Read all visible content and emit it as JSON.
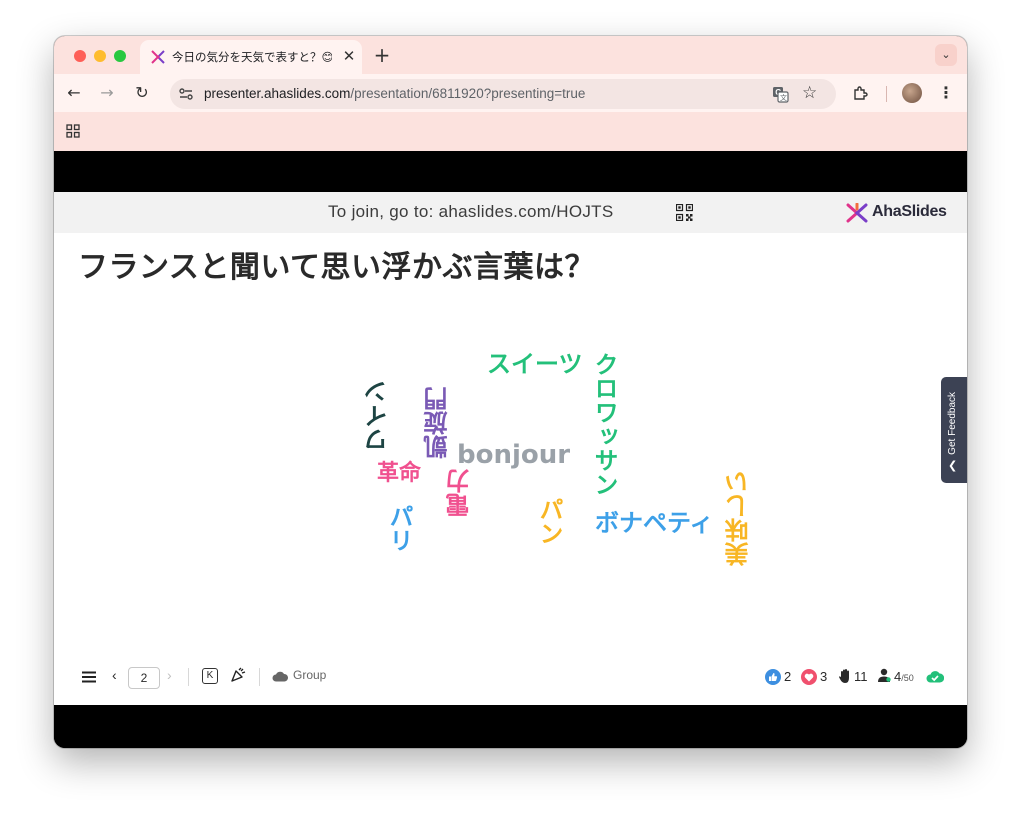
{
  "browser": {
    "tab": {
      "title": "今日の気分を天気で表すと？😊🌤️",
      "close": "✕"
    },
    "new_tab": "+",
    "tab_menu": "⌄",
    "url_host": "presenter.ahaslides.com",
    "url_path": "/presentation/6811920?presenting=true"
  },
  "slide": {
    "join_prefix": "To join, go to: ",
    "join_url": "ahaslides.com/HOJTS",
    "brand": "AhaSlides",
    "question": "フランスと聞いて思い浮かぶ言葉は？",
    "feedback_label": "Get Feedback"
  },
  "word_cloud": {
    "words": [
      {
        "text": "スイーツ",
        "color": "#23c07a",
        "orientation": "horizontal"
      },
      {
        "text": "ワイン",
        "color": "#1d4443",
        "orientation": "vertical"
      },
      {
        "text": "凱旋門",
        "color": "#7a5ab5",
        "orientation": "vertical"
      },
      {
        "text": "bonjour",
        "color": "#9aa1a8",
        "orientation": "horizontal"
      },
      {
        "text": "クロワッサン",
        "color": "#23c07a",
        "orientation": "vertical"
      },
      {
        "text": "革命",
        "color": "#f0508f",
        "orientation": "horizontal"
      },
      {
        "text": "電力",
        "color": "#f0508f",
        "orientation": "vertical"
      },
      {
        "text": "パリ",
        "color": "#3da0e8",
        "orientation": "vertical"
      },
      {
        "text": "パン",
        "color": "#f8b624",
        "orientation": "vertical"
      },
      {
        "text": "ボナペティ",
        "color": "#3da0e8",
        "orientation": "horizontal"
      },
      {
        "text": "美味しい",
        "color": "#f8b624",
        "orientation": "vertical"
      }
    ]
  },
  "bottom_bar": {
    "page": "2",
    "shortcut_key": "K",
    "group_label": "Group",
    "likes": "2",
    "hearts": "3",
    "hands": "11",
    "participants": "4",
    "participants_max": "/50"
  },
  "colors": {
    "accent_green": "#23c07a",
    "chrome": "#fce2de",
    "feedback_tab": "#3c4254"
  }
}
